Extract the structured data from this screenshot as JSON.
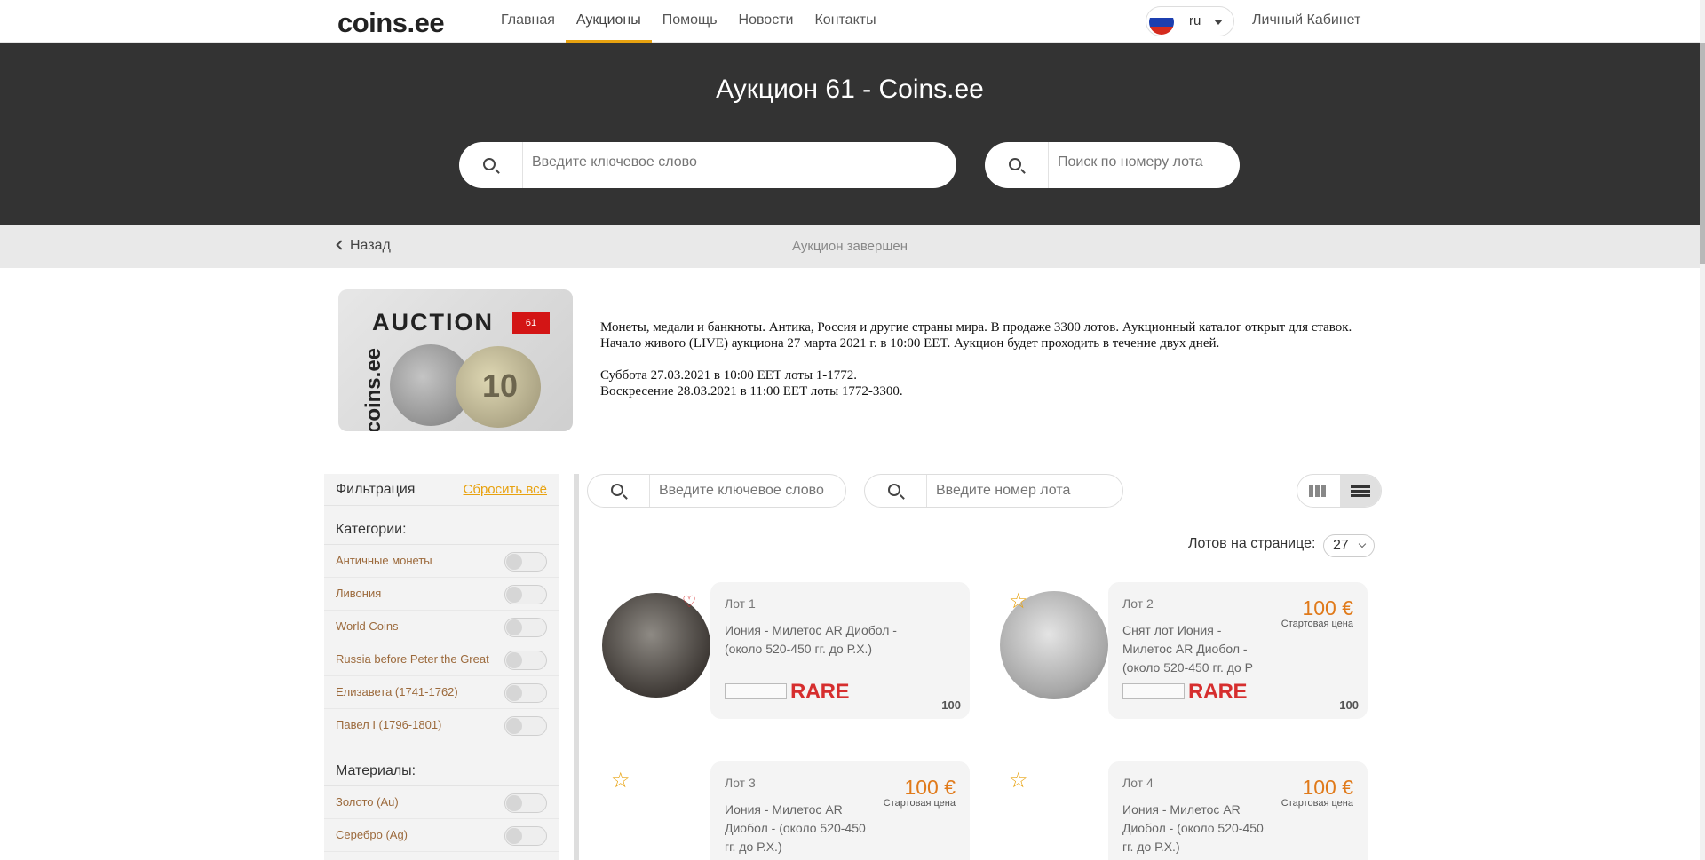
{
  "nav": {
    "logo": "coins.ee",
    "items": [
      "Главная",
      "Аукционы",
      "Помощь",
      "Новости",
      "Контакты"
    ],
    "language": "ru",
    "cabinet": "Личный Кабинет"
  },
  "hero": {
    "title": "Аукцион 61 - Coins.ee",
    "search_placeholder": "Введите ключевое слово",
    "lot_search_placeholder": "Поиск по номеру лота"
  },
  "subbar": {
    "back": "Назад",
    "status": "Аукцион завершен"
  },
  "banner": {
    "word": "AUCTION",
    "number": "61",
    "side": "coins.ee",
    "coin_text": "10"
  },
  "description": {
    "para1": "Монеты, медали и банкноты. Антика, Россия и другие страны мира. В продаже 3300 лотов. Аукционный каталог открыт для ставок. Начало живого (LIVE) аукциона 27 марта 2021 г. в 10:00 EET. Аукцион будет проходить в течение двух дней.",
    "line1": "Суббота 27.03.2021 в 10:00 EET лоты 1-1772.",
    "line2": "Воскресение 28.03.2021 в 11:00 EET лоты 1772-3300."
  },
  "sidebar": {
    "title": "Фильтрация",
    "reset": "Сбросить всё",
    "categories_title": "Категории:",
    "categories": [
      "Античные монеты",
      "Ливония",
      "World Coins",
      "Russia before Peter the Great",
      "Елизавета (1741-1762)",
      "Павел I (1796-1801)"
    ],
    "materials_title": "Материалы:",
    "materials": [
      "Золото (Au)",
      "Серебро (Ag)"
    ]
  },
  "filters": {
    "keyword_placeholder": "Введите ключевое слово",
    "lot_placeholder": "Введите номер лота",
    "per_page_label": "Лотов на странице:",
    "per_page_value": "27"
  },
  "lots": [
    {
      "num": "Лот 1",
      "title": "Иония - Милетос AR Диобол - (около 520-450 гг. до Р.Х.)",
      "price": "",
      "price_label": "",
      "rare": "RARE",
      "count": "100"
    },
    {
      "num": "Лот 2",
      "title": "Снят лот Иония - Милетос AR Диобол - (около 520-450 гг. до Р",
      "price": "100 €",
      "price_label": "Стартовая цена",
      "rare": "RARE",
      "count": "100"
    },
    {
      "num": "Лот 3",
      "title": "Иония - Милетос AR Диобол - (около 520-450 гг. до Р.Х.)",
      "price": "100 €",
      "price_label": "Стартовая цена",
      "rare": "",
      "count": ""
    },
    {
      "num": "Лот 4",
      "title": "Иония - Милетос AR Диобол - (около 520-450 гг. до Р.Х.)",
      "price": "100 €",
      "price_label": "Стартовая цена",
      "rare": "",
      "count": ""
    }
  ],
  "colors": {
    "accent": "#e8a20f",
    "price": "#e07a1a",
    "rare": "#d62e2e",
    "hero_bg": "#333333"
  }
}
